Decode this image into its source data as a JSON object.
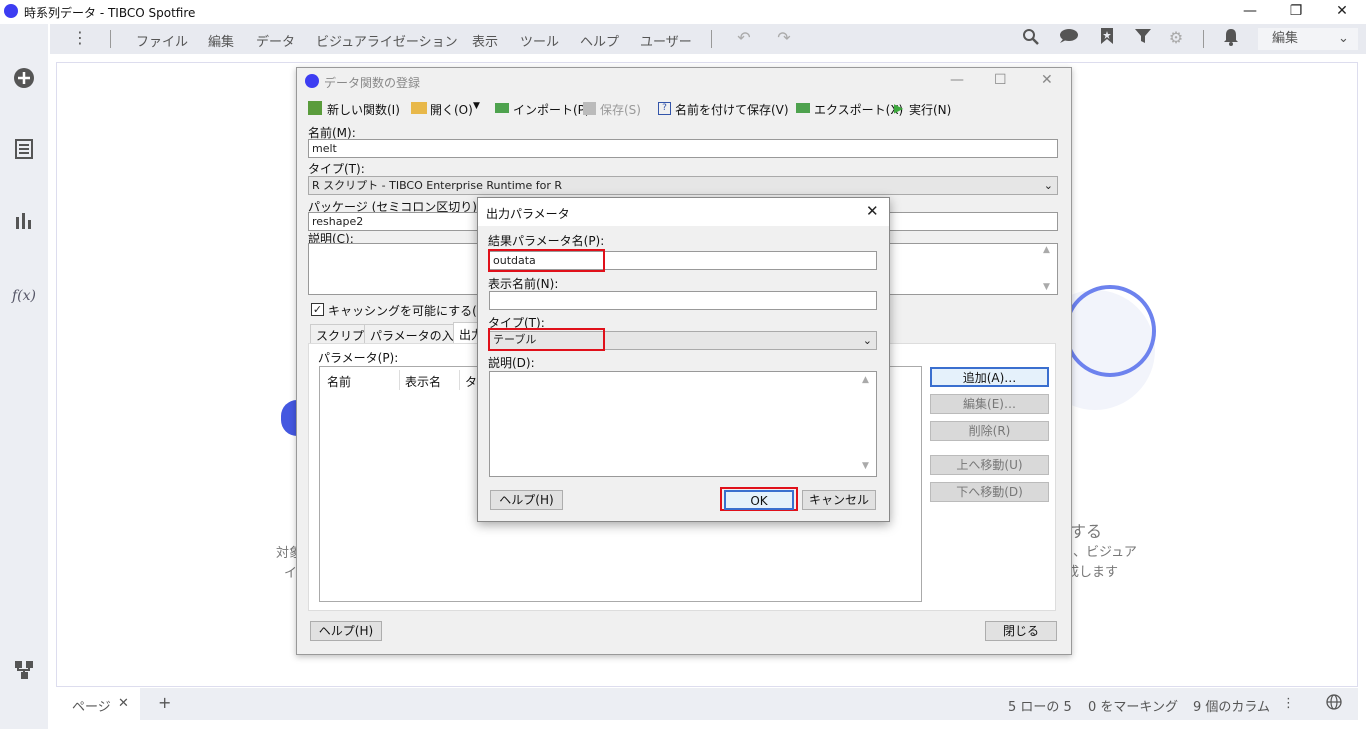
{
  "app": {
    "title": "時系列データ - TIBCO Spotfire"
  },
  "window_controls": {
    "minimize": "—",
    "maximize": "❐",
    "close": "✕"
  },
  "menu": [
    "ファイル",
    "編集",
    "データ",
    "ビジュアライゼーション",
    "表示",
    "ツール",
    "ヘルプ",
    "ユーザー"
  ],
  "toolbar": {
    "mode_select": "編集"
  },
  "left_rail": {
    "fx": "f(x)"
  },
  "background_text": {
    "line1_left": "対象",
    "line2_left": "イ",
    "line1_right": "する",
    "line2_right": "ム、ビジュア",
    "line3_right": "成します"
  },
  "bottom": {
    "page_tab": "ページ",
    "rows": "5 ローの 5",
    "marking": "0 をマーキング",
    "columns": "9 個のカラム"
  },
  "register_dialog": {
    "title": "データ関数の登録",
    "toolbar": {
      "new": "新しい関数(I)",
      "open": "開く(O)",
      "import": "インポート(P)",
      "save": "保存(S)",
      "save_as": "名前を付けて保存(V)",
      "export": "エクスポート(X)",
      "run": "実行(N)"
    },
    "name_label": "名前(M):",
    "name_value": "melt",
    "type_label": "タイプ(T):",
    "type_value": "R スクリプト - TIBCO Enterprise Runtime for R",
    "package_label": "パッケージ (セミコロン区切り)(K):",
    "package_value": "reshape2",
    "desc_label": "説明(C):",
    "caching_label": "キャッシングを可能にする(W)",
    "tabs": [
      "スクリプト",
      "パラメータの入力",
      "出力"
    ],
    "params_label": "パラメータ(P):",
    "columns": [
      "名前",
      "表示名",
      "タ"
    ],
    "buttons": {
      "add": "追加(A)…",
      "edit": "編集(E)…",
      "delete": "削除(R)",
      "move_up": "上へ移動(U)",
      "move_down": "下へ移動(D)",
      "help": "ヘルプ(H)",
      "close": "閉じる"
    }
  },
  "output_dialog": {
    "title": "出力パラメータ",
    "result_label": "結果パラメータ名(P):",
    "result_value": "outdata",
    "display_label": "表示名前(N):",
    "display_value": "",
    "type_label": "タイプ(T):",
    "type_value": "テーブル",
    "desc_label": "説明(D):",
    "help": "ヘルプ(H)",
    "ok": "OK",
    "cancel": "キャンセル"
  }
}
